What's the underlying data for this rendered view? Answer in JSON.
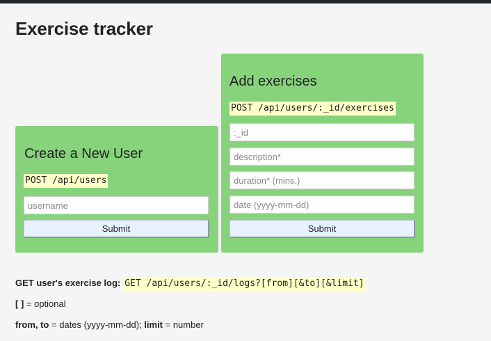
{
  "header": {
    "title": "Exercise tracker"
  },
  "create_user": {
    "title": "Create a New User",
    "endpoint": "POST /api/users",
    "username_placeholder": "username",
    "submit_label": "Submit"
  },
  "add_exercise": {
    "title": "Add exercises",
    "endpoint": "POST /api/users/:_id/exercises",
    "id_placeholder": ":_id",
    "description_placeholder": "description*",
    "duration_placeholder": "duration* (mins.)",
    "date_placeholder": "date (yyyy-mm-dd)",
    "submit_label": "Submit"
  },
  "info": {
    "log_label": "GET user's exercise log:",
    "log_endpoint": "GET /api/users/:_id/logs?[from][&to][&limit]",
    "optional_symbol": "[ ]",
    "optional_text": " = optional",
    "from_to_label": "from, to",
    "from_to_text": " = dates (yyyy-mm-dd); ",
    "limit_label": "limit",
    "limit_text": " = number"
  },
  "colors": {
    "card_background": "#87d37c",
    "code_highlight": "#ffffc8",
    "button_background": "#e6f2ff",
    "page_background": "#f5f5f5"
  }
}
